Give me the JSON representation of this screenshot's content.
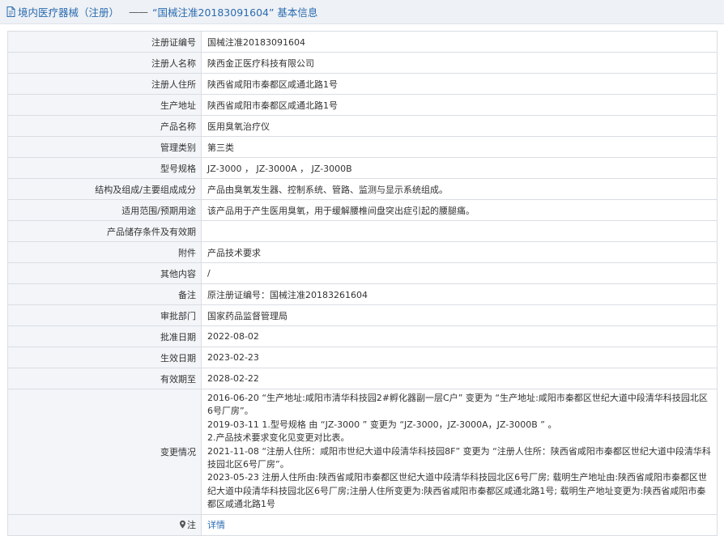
{
  "header": {
    "crumb": "境内医疗器械（注册）",
    "separator": "——",
    "title": "“国械注准20183091604” 基本信息"
  },
  "rows": [
    {
      "label": "注册证编号",
      "value": "国械注准20183091604"
    },
    {
      "label": "注册人名称",
      "value": "陕西金正医疗科技有限公司"
    },
    {
      "label": "注册人住所",
      "value": "陕西省咸阳市秦都区咸通北路1号"
    },
    {
      "label": "生产地址",
      "value": "陕西省咸阳市秦都区咸通北路1号"
    },
    {
      "label": "产品名称",
      "value": "医用臭氧治疗仪"
    },
    {
      "label": "管理类别",
      "value": "第三类"
    },
    {
      "label": "型号规格",
      "value": "JZ-3000 ，  JZ-3000A ，  JZ-3000B"
    },
    {
      "label": "结构及组成/主要组成成分",
      "value": "产品由臭氧发生器、控制系统、管路、监测与显示系统组成。"
    },
    {
      "label": "适用范围/预期用途",
      "value": "该产品用于产生医用臭氧，用于缓解腰椎间盘突出症引起的腰腿痛。"
    },
    {
      "label": "产品储存条件及有效期",
      "value": ""
    },
    {
      "label": "附件",
      "value": "产品技术要求"
    },
    {
      "label": "其他内容",
      "value": "/"
    },
    {
      "label": "备注",
      "value": "原注册证编号：国械注准20183261604"
    },
    {
      "label": "审批部门",
      "value": "国家药品监督管理局"
    },
    {
      "label": "批准日期",
      "value": "2022-08-02"
    },
    {
      "label": "生效日期",
      "value": "2023-02-23"
    },
    {
      "label": "有效期至",
      "value": "2028-02-22"
    }
  ],
  "changes": {
    "label": "变更情况",
    "lines": [
      "2016-06-20 “生产地址:咸阳市清华科技园2#孵化器副一层C户” 变更为 “生产地址:咸阳市秦都区世纪大道中段清华科技园北区6号厂房”。",
      "2019-03-11 1.型号规格 由 “JZ-3000 ” 变更为 “JZ-3000，JZ-3000A，JZ-3000B ” 。",
      "2.产品技术要求变化见变更对比表。",
      "2021-11-08 “注册人住所：咸阳市世纪大道中段清华科技园8F” 变更为 “注册人住所：陕西省咸阳市秦都区世纪大道中段清华科技园北区6号厂房”。",
      "2023-05-23 注册人住所由:陕西省咸阳市秦都区世纪大道中段清华科技园北区6号厂房; 载明生产地址由:陕西省咸阳市秦都区世纪大道中段清华科技园北区6号厂房;注册人住所变更为:陕西省咸阳市秦都区咸通北路1号; 载明生产地址变更为:陕西省咸阳市秦都区咸通北路1号"
    ]
  },
  "note": {
    "label": "注",
    "link": "详情"
  },
  "colors": {
    "accent": "#2a6bb0",
    "label_bg": "#f3f5f8",
    "border": "#d9dde3",
    "header_bg": "#eef1f5"
  },
  "icons": {
    "header": "document-icon",
    "note": "map-pin-icon"
  }
}
